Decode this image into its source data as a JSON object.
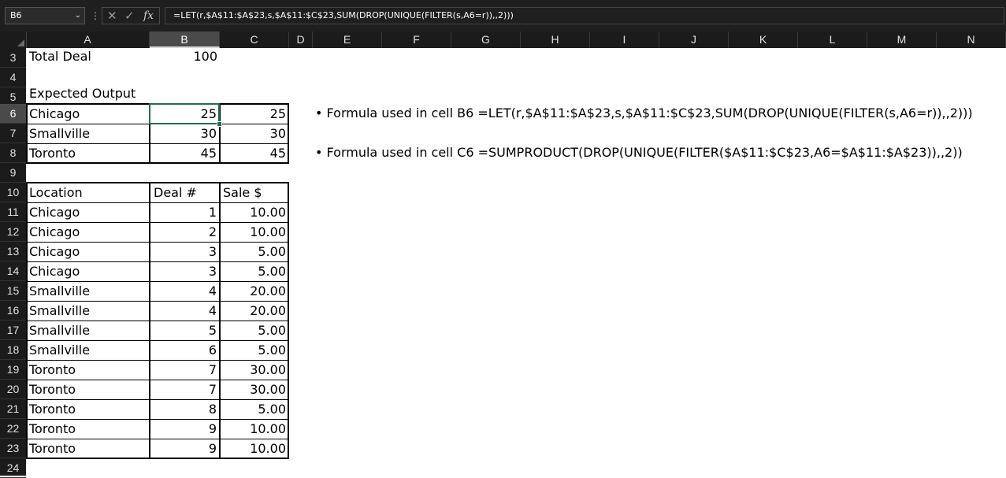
{
  "formula_bar": {
    "name_box": "B6",
    "formula": "=LET(r,$A$11:$A$23,s,$A$11:$C$23,SUM(DROP(UNIQUE(FILTER(s,A6=r)),,2)))"
  },
  "columns": [
    "A",
    "B",
    "C",
    "D",
    "E",
    "F",
    "G",
    "H",
    "I",
    "J",
    "K",
    "L",
    "M",
    "N"
  ],
  "rows": [
    "3",
    "4",
    "5",
    "6",
    "7",
    "8",
    "9",
    "10",
    "11",
    "12",
    "13",
    "14",
    "15",
    "16",
    "17",
    "18",
    "19",
    "20",
    "21",
    "22",
    "23",
    "24"
  ],
  "sheet": {
    "total_deal_label": "Total Deal",
    "total_deal_value": "100",
    "expected_output_label": "Expected Output",
    "expected_output": [
      {
        "location": "Chicago",
        "b": "25",
        "c": "25"
      },
      {
        "location": "Smallville",
        "b": "30",
        "c": "30"
      },
      {
        "location": "Toronto",
        "b": "45",
        "c": "45"
      }
    ],
    "table_headers": [
      "Location",
      "Deal #",
      "Sale $"
    ],
    "table_rows": [
      {
        "location": "Chicago",
        "deal": "1",
        "sale": "10.00"
      },
      {
        "location": "Chicago",
        "deal": "2",
        "sale": "10.00"
      },
      {
        "location": "Chicago",
        "deal": "3",
        "sale": "5.00"
      },
      {
        "location": "Chicago",
        "deal": "3",
        "sale": "5.00"
      },
      {
        "location": "Smallville",
        "deal": "4",
        "sale": "20.00"
      },
      {
        "location": "Smallville",
        "deal": "4",
        "sale": "20.00"
      },
      {
        "location": "Smallville",
        "deal": "5",
        "sale": "5.00"
      },
      {
        "location": "Smallville",
        "deal": "6",
        "sale": "5.00"
      },
      {
        "location": "Toronto",
        "deal": "7",
        "sale": "30.00"
      },
      {
        "location": "Toronto",
        "deal": "7",
        "sale": "30.00"
      },
      {
        "location": "Toronto",
        "deal": "8",
        "sale": "5.00"
      },
      {
        "location": "Toronto",
        "deal": "9",
        "sale": "10.00"
      },
      {
        "location": "Toronto",
        "deal": "9",
        "sale": "10.00"
      }
    ],
    "notes": [
      "• Formula used in cell B6 =LET(r,$A$11:$A$23,s,$A$11:$C$23,SUM(DROP(UNIQUE(FILTER(s,A6=r)),,2)))",
      "• Formula used in cell C6 =SUMPRODUCT(DROP(UNIQUE(FILTER($A$11:$C$23,A6=$A$11:$A$23)),,2))"
    ]
  },
  "icons": {
    "name_box_dropdown": "chevron-down-icon",
    "cancel": "x-icon",
    "enter": "check-icon",
    "insert_function": "fx-icon"
  },
  "colors": {
    "active_cell_border": "#1e7145",
    "header_bg": "#1b1b1b"
  }
}
